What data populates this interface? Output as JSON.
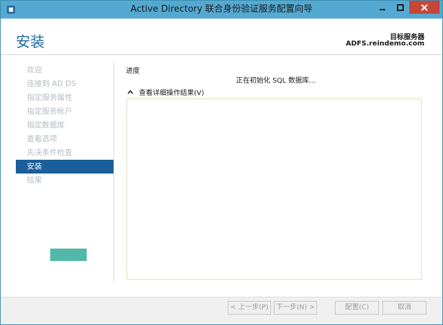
{
  "window": {
    "title": "Active Directory 联合身份验证服务配置向导"
  },
  "icons": {
    "app": "adfs-app-icon",
    "minimize": "minimize-icon",
    "maximize": "maximize-icon",
    "close": "close-icon",
    "expand": "chevron-up-icon"
  },
  "header": {
    "page_title": "安装",
    "target_label": "目标服务器",
    "target_value": "ADFS.reindemo.com"
  },
  "nav": {
    "items": [
      {
        "label": "欢迎",
        "state": "done"
      },
      {
        "label": "连接到 AD DS",
        "state": "done"
      },
      {
        "label": "指定服务属性",
        "state": "done"
      },
      {
        "label": "指定服务帐户",
        "state": "done"
      },
      {
        "label": "指定数据库",
        "state": "done"
      },
      {
        "label": "查看选项",
        "state": "done"
      },
      {
        "label": "先决条件检查",
        "state": "done"
      },
      {
        "label": "安装",
        "state": "active"
      },
      {
        "label": "结果",
        "state": "next"
      }
    ]
  },
  "main": {
    "progress_label": "进度",
    "status_text": "正在初始化 SQL 数据库...",
    "details_toggle": "查看详细操作结果(V)"
  },
  "footer": {
    "prev": "< 上一步(P)",
    "next": "下一步(N) >",
    "configure": "配置(C)",
    "cancel": "取消"
  },
  "colors": {
    "titlebar": "#54a9d2",
    "accent": "#1d6aa5",
    "nav_active": "#1b5e99",
    "close_button": "#c7463a"
  }
}
